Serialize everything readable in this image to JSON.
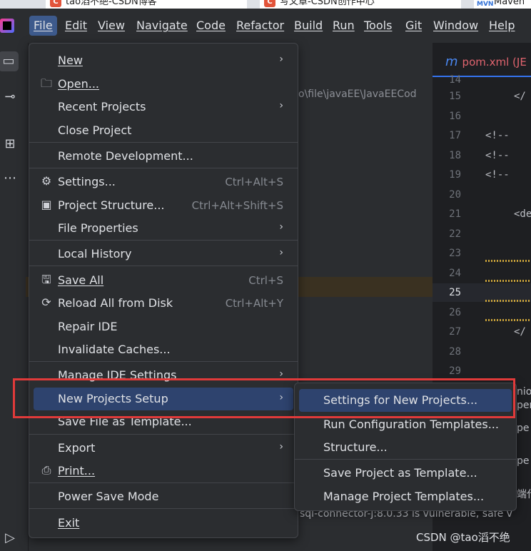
{
  "browser_tabs": [
    {
      "label": "tao滔不绝-CSDN博客",
      "icon": "csdn-icon"
    },
    {
      "label": "写文章-CSDN创作中心",
      "icon": "csdn-icon"
    },
    {
      "label": "Maven",
      "icon": "maven-icon"
    }
  ],
  "menubar": {
    "items": [
      "File",
      "Edit",
      "View",
      "Navigate",
      "Code",
      "Refactor",
      "Build",
      "Run",
      "Tools",
      "Git",
      "Window",
      "Help"
    ],
    "active": "File"
  },
  "file_menu": {
    "new": "New",
    "open": "Open...",
    "recent_projects": "Recent Projects",
    "close_project": "Close Project",
    "remote_development": "Remote Development...",
    "settings": "Settings...",
    "settings_shortcut": "Ctrl+Alt+S",
    "project_structure": "Project Structure...",
    "project_structure_shortcut": "Ctrl+Alt+Shift+S",
    "file_properties": "File Properties",
    "local_history": "Local History",
    "save_all": "Save All",
    "save_all_shortcut": "Ctrl+S",
    "reload_all": "Reload All from Disk",
    "reload_all_shortcut": "Ctrl+Alt+Y",
    "repair_ide": "Repair IDE",
    "invalidate_caches": "Invalidate Caches...",
    "manage_ide_settings": "Manage IDE Settings",
    "new_projects_setup": "New Projects Setup",
    "save_file_as_template": "Save File as Template...",
    "export": "Export",
    "print": "Print...",
    "power_save_mode": "Power Save Mode",
    "exit": "Exit"
  },
  "submenu": {
    "settings_for_new_projects": "Settings for New Projects...",
    "run_configuration_templates": "Run Configuration Templates...",
    "structure": "Structure...",
    "save_project_as_template": "Save Project as Template...",
    "manage_project_templates": "Manage Project Templates..."
  },
  "editor": {
    "tab_label": "pom.xml (JE",
    "path_fragment": "o\\file\\javaEE\\JavaEECod",
    "line_numbers": [
      "14",
      "15",
      "16",
      "17",
      "18",
      "19",
      "20",
      "21",
      "22",
      "23",
      "24",
      "25",
      "26",
      "27",
      "28",
      "29"
    ],
    "current_line": "25",
    "code_15": "</",
    "code_17": "<!--",
    "code_18": "<!--",
    "code_19": "<!--",
    "code_21": "<de",
    "code_27": "</",
    "vuln_text": "sql-connector-j:8.0.33 is vulnerable, safe v",
    "edge_1": "nio",
    "edge_2": "pen",
    "edge_3": "pe",
    "edge_4": "pe",
    "edge_5": "端代"
  },
  "watermark": "CSDN @tao滔不绝",
  "colors": {
    "menu_bg": "#2b2d30",
    "highlight": "#2e436e",
    "annotation": "#e03a3a"
  }
}
